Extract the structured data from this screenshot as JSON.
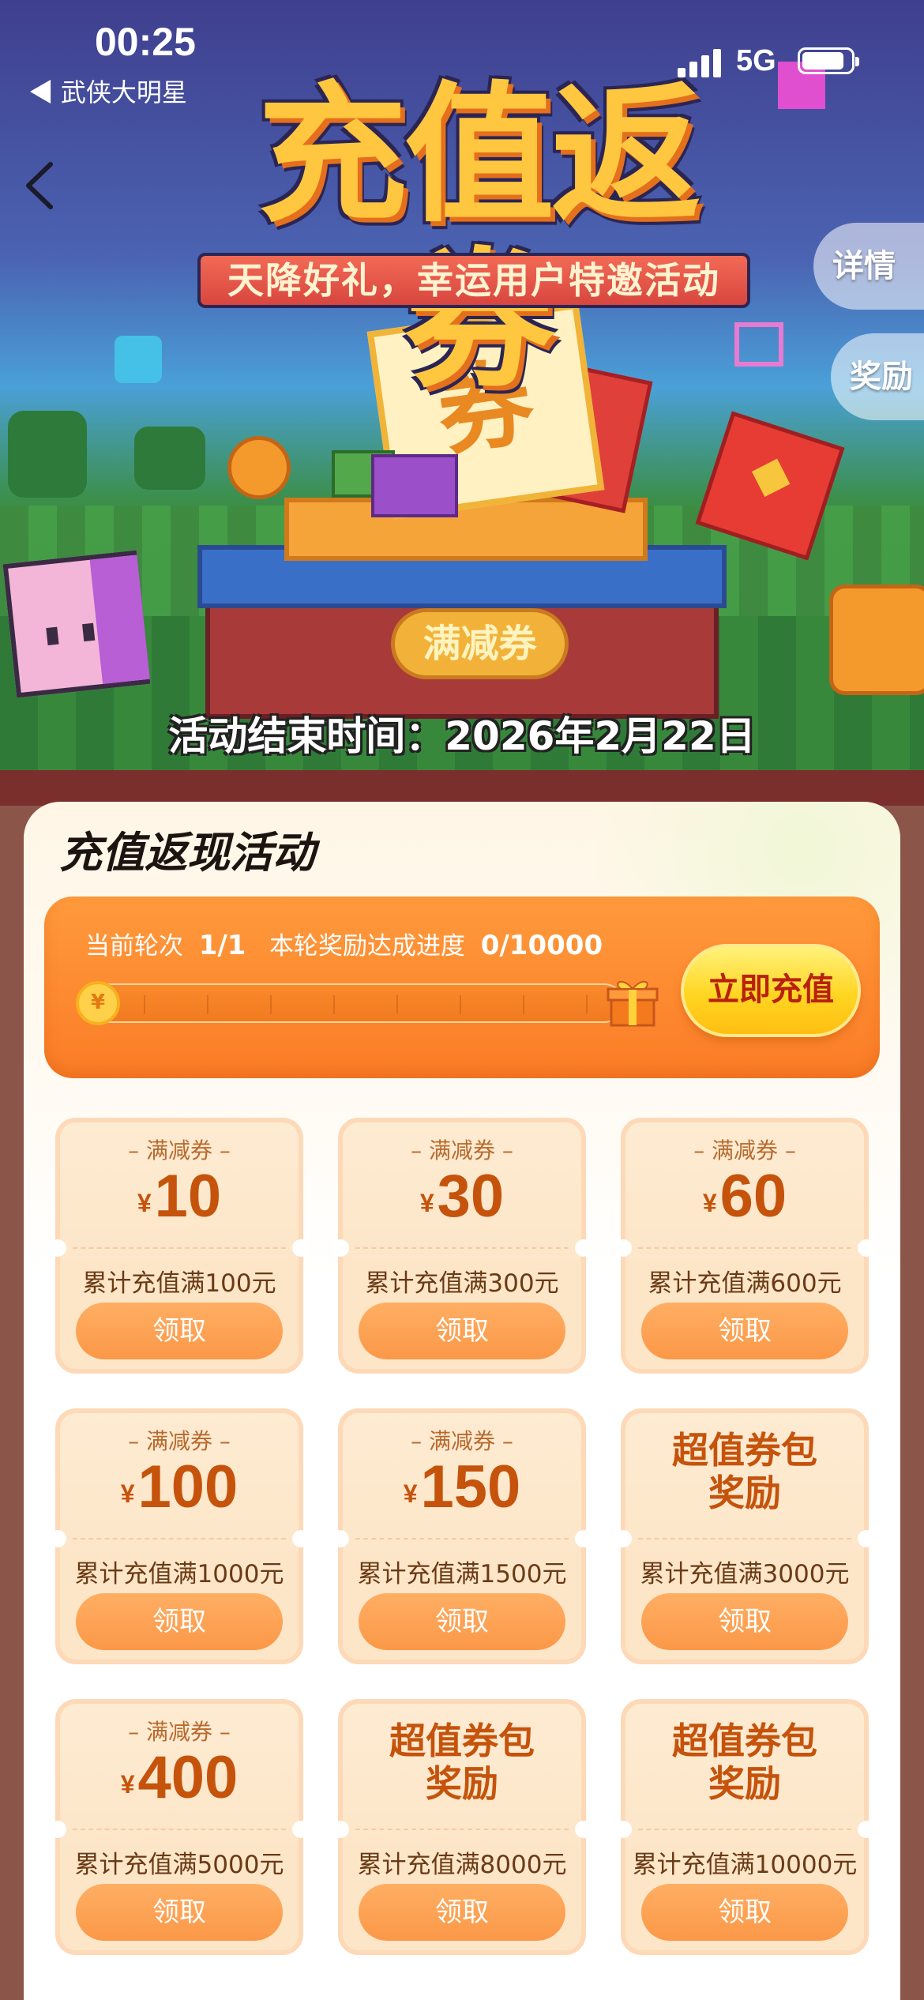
{
  "status_bar": {
    "time": "00:25",
    "back_app": "◀ 武侠大明星",
    "network": "5G"
  },
  "banner": {
    "title": "充值返券",
    "subtitle": "天降好礼，幸运用户特邀活动",
    "ticket_char": "券",
    "stage_label": "满减券",
    "end_time": "活动结束时间：2026年2月22日"
  },
  "side_tabs": {
    "detail": "详情",
    "reward": "奖励"
  },
  "activity": {
    "title": "充值返现活动",
    "round_label": "当前轮次",
    "round_value": "1/1",
    "progress_label": "本轮奖励达成进度",
    "progress_value": "0/10000",
    "progress_fraction": 0,
    "coin_symbol": "¥",
    "recharge_button": "立即充值"
  },
  "rewards": [
    {
      "type": "– 满减券 –",
      "currency": "¥",
      "amount": "10",
      "condition": "累计充值满100元",
      "button": "领取"
    },
    {
      "type": "– 满减券 –",
      "currency": "¥",
      "amount": "30",
      "condition": "累计充值满300元",
      "button": "领取"
    },
    {
      "type": "– 满减券 –",
      "currency": "¥",
      "amount": "60",
      "condition": "累计充值满600元",
      "button": "领取"
    },
    {
      "type": "– 满减券 –",
      "currency": "¥",
      "amount": "100",
      "condition": "累计充值满1000元",
      "button": "领取"
    },
    {
      "type": "– 满减券 –",
      "currency": "¥",
      "amount": "150",
      "condition": "累计充值满1500元",
      "button": "领取"
    },
    {
      "pack_line1": "超值券包",
      "pack_line2": "奖励",
      "condition": "累计充值满3000元",
      "button": "领取"
    },
    {
      "type": "– 满减券 –",
      "currency": "¥",
      "amount": "400",
      "condition": "累计充值满5000元",
      "button": "领取"
    },
    {
      "pack_line1": "超值券包",
      "pack_line2": "奖励",
      "condition": "累计充值满8000元",
      "button": "领取"
    },
    {
      "pack_line1": "超值券包",
      "pack_line2": "奖励",
      "condition": "累计充值满10000元",
      "button": "领取"
    }
  ],
  "colors": {
    "accent_orange": "#fb7c26",
    "button_yellow": "#ffd522",
    "coupon_text": "#c5530c",
    "claim_button": "#fb9848"
  }
}
